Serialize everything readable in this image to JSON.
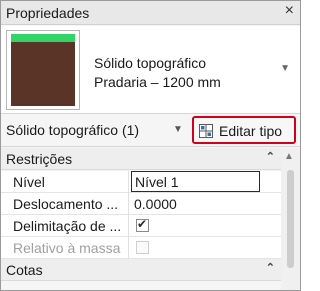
{
  "panel": {
    "title": "Propriedades",
    "close_icon": "×"
  },
  "type_selector": {
    "name_line1": "Sólido topográfico",
    "name_line2": "Pradaria – 1200 mm",
    "dropdown_icon": "▼"
  },
  "instance": {
    "label": "Sólido topográfico (1)",
    "dropdown_icon": "▼",
    "edit_type_label": "Editar tipo"
  },
  "groups": [
    {
      "label": "Restrições",
      "collapse_icon": "⌃"
    },
    {
      "label": "Cotas",
      "collapse_icon": "⌃"
    }
  ],
  "properties": [
    {
      "name": "Nível",
      "value": "Nível 1"
    },
    {
      "name": "Deslocamento ...",
      "value": "0.0000"
    },
    {
      "name": "Delimitação de ...",
      "checked": true,
      "check_glyph": "✔"
    },
    {
      "name": "Relativo à massa",
      "checked": false,
      "disabled": true
    }
  ],
  "scrollbar": {
    "up_icon": "▲"
  },
  "colors": {
    "highlight_border": "#d0021b",
    "thumbnail_top": "#33d466",
    "thumbnail_body": "#5a3527"
  }
}
